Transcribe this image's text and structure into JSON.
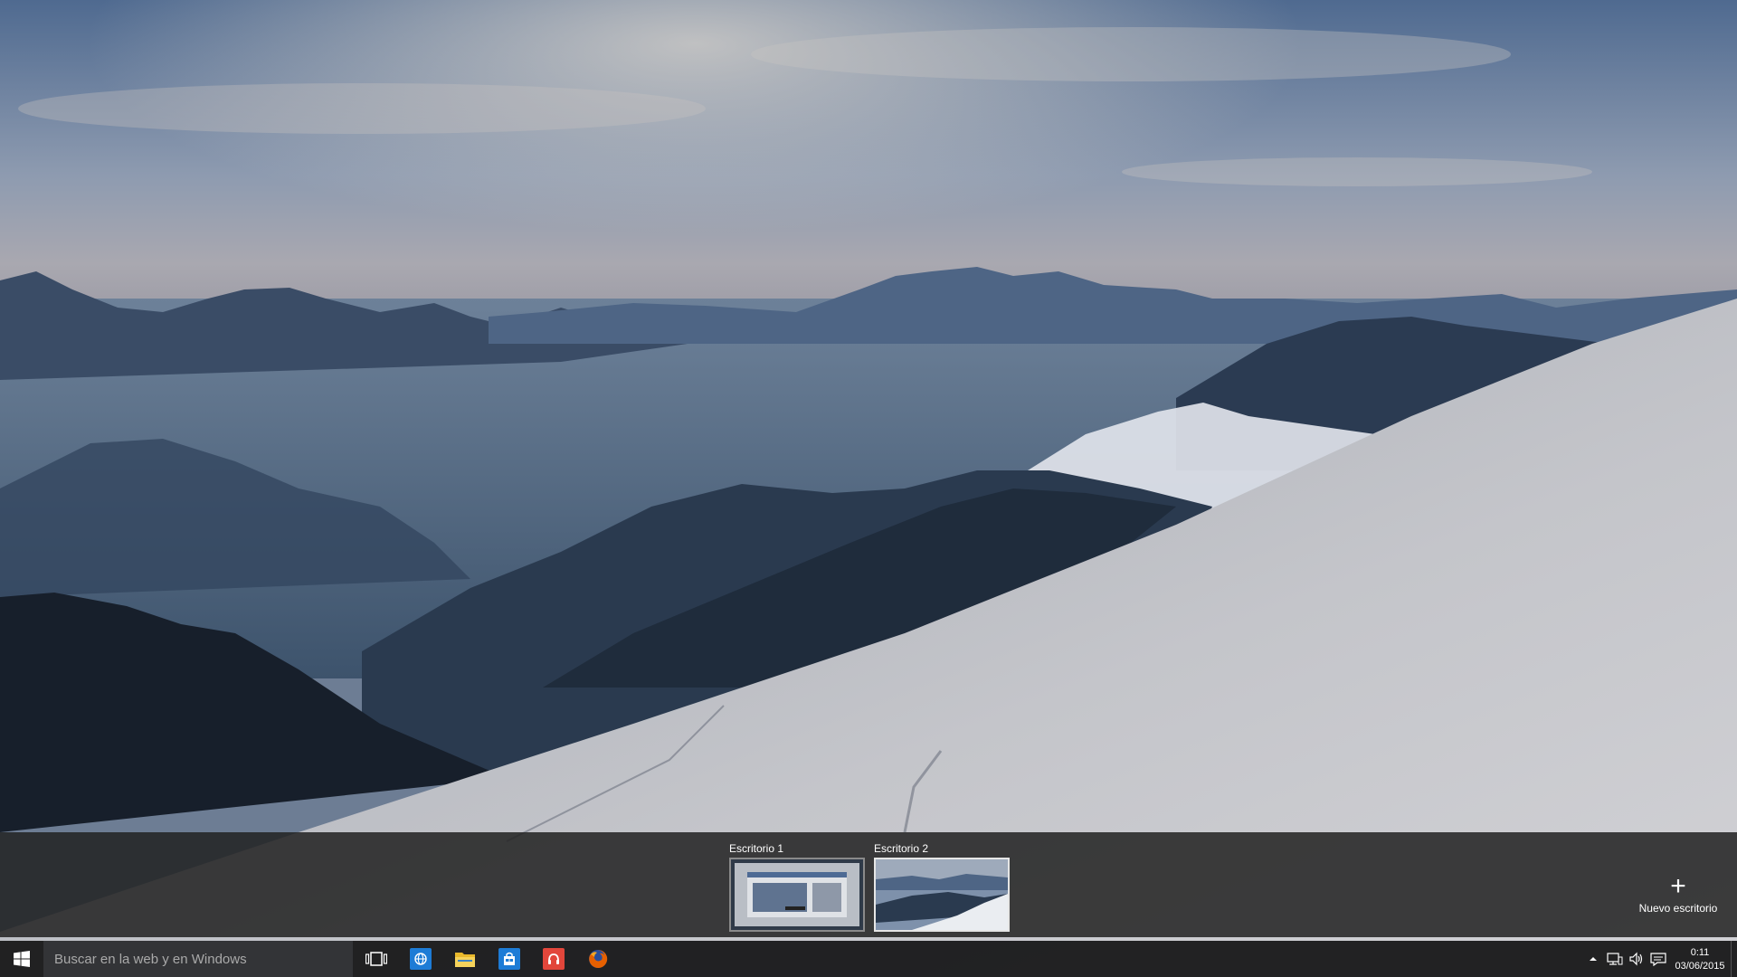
{
  "wallpaper": {
    "description_icon": "mountain-landscape"
  },
  "task_view": {
    "desktops": [
      {
        "label": "Escritorio 1",
        "active": false
      },
      {
        "label": "Escritorio 2",
        "active": true
      }
    ],
    "new_desktop": {
      "icon": "plus-icon",
      "label": "Nuevo escritorio"
    }
  },
  "taskbar": {
    "start_icon": "windows-logo-icon",
    "search": {
      "placeholder": "Buscar en la web y en Windows",
      "value": ""
    },
    "task_view_icon": "task-view-icon",
    "pinned_apps": [
      {
        "name": "Internet Explorer",
        "icon": "globe-icon",
        "color": "#1d7cd6"
      },
      {
        "name": "Explorador de archivos",
        "icon": "folder-icon",
        "color": "#f2c230"
      },
      {
        "name": "Tienda",
        "icon": "store-icon",
        "color": "#1d7cd6"
      },
      {
        "name": "Música",
        "icon": "headphones-icon",
        "color": "#e2463b"
      },
      {
        "name": "Firefox",
        "icon": "firefox-icon",
        "color": "#e66000"
      }
    ],
    "tray": {
      "icons": [
        "chevron-up-icon",
        "network-icon",
        "volume-icon",
        "notification-icon"
      ],
      "time": "0:11",
      "date": "03/06/2015"
    }
  }
}
